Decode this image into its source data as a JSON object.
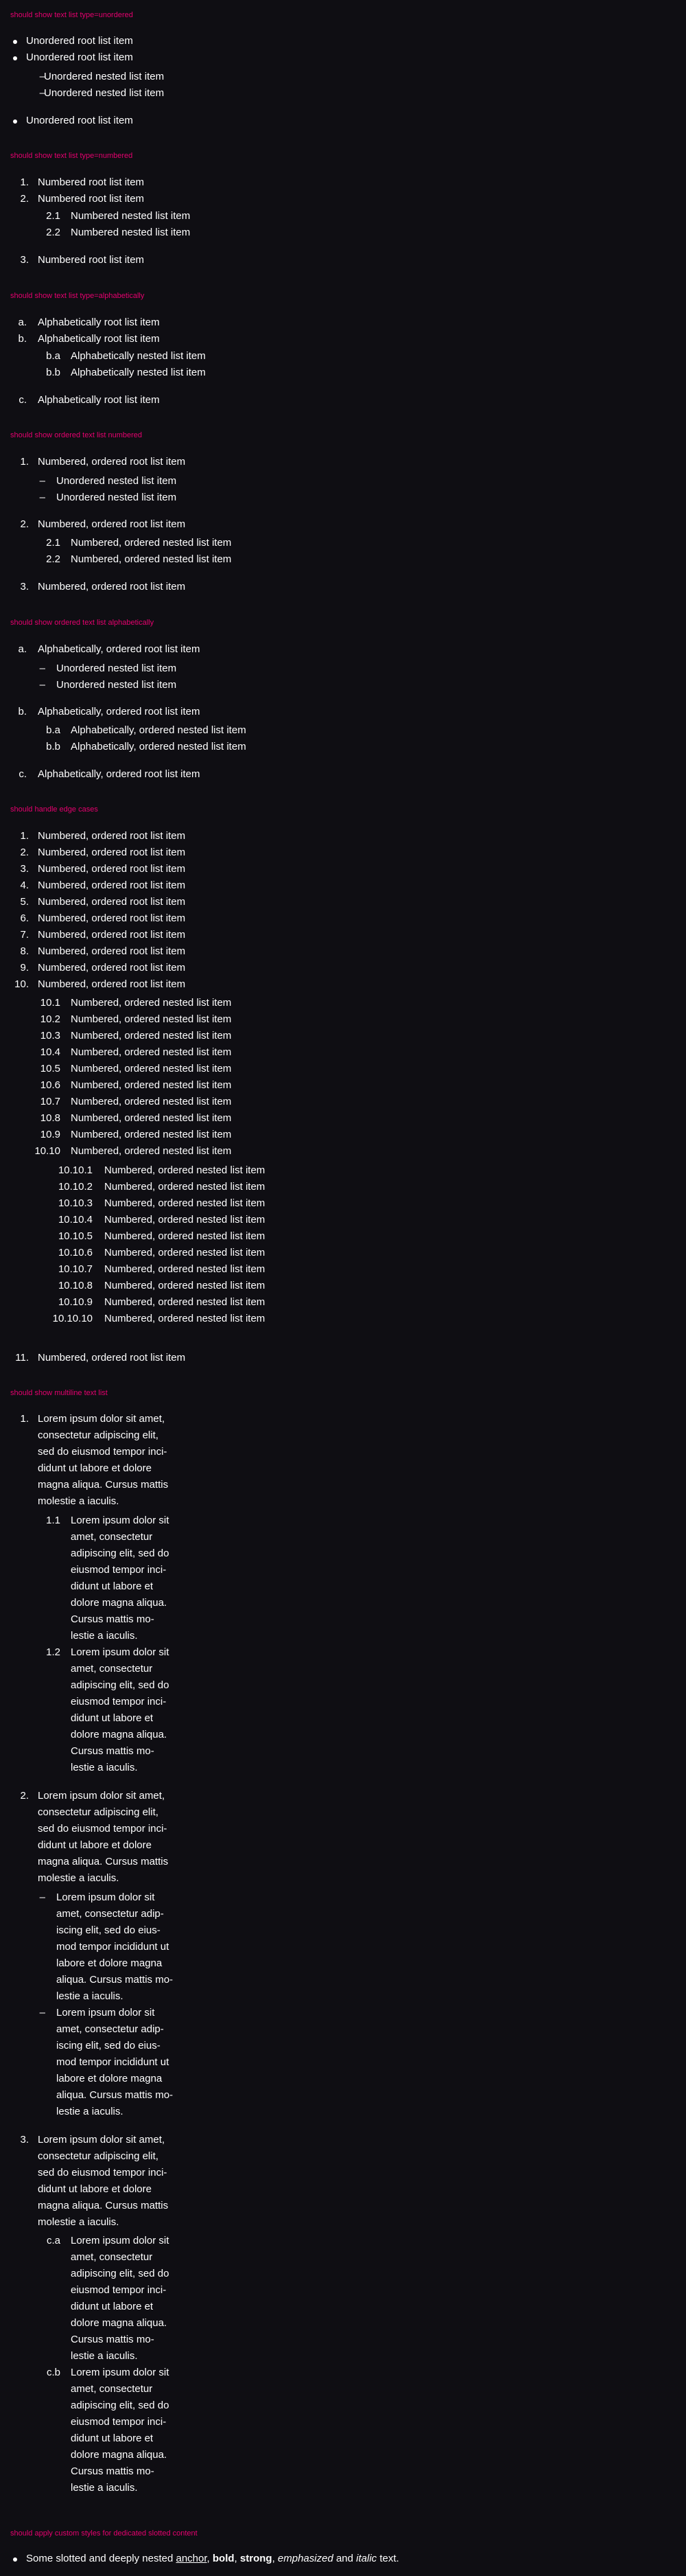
{
  "sections": {
    "unordered": {
      "heading": "should show text list type=unordered",
      "root_item": "Unordered root list item",
      "nested_item": "Unordered nested list item",
      "marker": "–"
    },
    "numbered": {
      "heading": "should show text list type=numbered",
      "root_item": "Numbered root list item",
      "nested_item": "Numbered nested list item",
      "markers": [
        "1.",
        "2.",
        "2.1",
        "2.2",
        "3."
      ]
    },
    "alphabetically": {
      "heading": "should show text list type=alphabetically",
      "root_item": "Alphabetically root list item",
      "nested_item": "Alphabetically nested list item",
      "markers": [
        "a.",
        "b.",
        "b.a",
        "b.b",
        "c."
      ]
    },
    "ordered_numbered": {
      "heading": "should show ordered text list numbered",
      "root_item": "Numbered, ordered root list item",
      "unordered_nested": "Unordered nested list item",
      "nested_item": "Numbered, ordered nested list item",
      "markers": [
        "1.",
        "–",
        "–",
        "2.",
        "2.1",
        "2.2",
        "3."
      ]
    },
    "ordered_alpha": {
      "heading": "should show ordered text list alphabetically",
      "root_item": "Alphabetically, ordered root list item",
      "unordered_nested": "Unordered nested list item",
      "nested_item": "Alphabetically, ordered nested list item",
      "markers": [
        "a.",
        "–",
        "–",
        "b.",
        "b.a",
        "b.b",
        "c."
      ]
    },
    "edge_cases": {
      "heading": "should handle edge cases",
      "root_item": "Numbered, ordered root list item",
      "nested_item": "Numbered, ordered nested list item",
      "root_markers": [
        "1.",
        "2.",
        "3.",
        "4.",
        "5.",
        "6.",
        "7.",
        "8.",
        "9.",
        "10."
      ],
      "nested_markers": [
        "10.1",
        "10.2",
        "10.3",
        "10.4",
        "10.5",
        "10.6",
        "10.7",
        "10.8",
        "10.9",
        "10.10"
      ],
      "deep_markers": [
        "10.10.1",
        "10.10.2",
        "10.10.3",
        "10.10.4",
        "10.10.5",
        "10.10.6",
        "10.10.7",
        "10.10.8",
        "10.10.9",
        "10.10.10"
      ],
      "last_marker": "11."
    },
    "multiline": {
      "heading": "should show multiline text list",
      "root_lines": [
        "Lorem ipsum dolor sit amet,",
        "consectetur adipiscing elit,",
        "sed do eiusmod tempor inci-",
        "didunt ut labore et dolore",
        "magna aliqua. Cursus mattis",
        "molestie a iaculis."
      ],
      "nested_lines": [
        "Lorem ipsum dolor sit",
        "amet, consectetur",
        "adipiscing elit, sed do",
        "eiusmod tempor inci-",
        "didunt ut labore et",
        "dolore magna aliqua.",
        "Cursus mattis mo-",
        "lestie a iaculis."
      ],
      "unordered_lines": [
        "Lorem ipsum dolor sit",
        "amet, consectetur adip-",
        "iscing elit, sed do eius-",
        "mod tempor incididunt ut",
        "labore et dolore magna",
        "aliqua. Cursus mattis mo-",
        "lestie a iaculis."
      ],
      "markers": [
        "1.",
        "1.1",
        "1.2",
        "2.",
        "–",
        "–",
        "3.",
        "c.a",
        "c.b"
      ]
    },
    "slotted": {
      "heading": "should apply custom styles for dedicated slotted content",
      "lead": "Some slotted and deeply nested",
      "anchor": "anchor",
      "comma1": ",",
      "bold": "bold",
      "comma2": ",",
      "strong": "strong",
      "comma3": ",",
      "emphasized": "emphasized",
      "and": "and",
      "italic": "italic",
      "end": "text."
    }
  },
  "colors": {
    "background": "#0f0e13",
    "text": "#ffffff",
    "heading": "#e5006e"
  }
}
